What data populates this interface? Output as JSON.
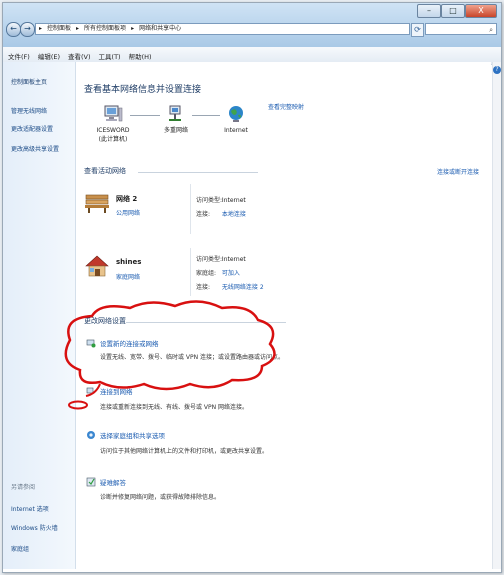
{
  "window": {
    "min_label": "–",
    "max_label": "□",
    "close_label": "X"
  },
  "address_bar": {
    "back_icon": "←",
    "forward_icon": "→",
    "parts": [
      "控制面板",
      "所有控制面板项",
      "网络和共享中心"
    ],
    "separator": "▸",
    "refresh_icon": "⟳",
    "search_icon": "⌕"
  },
  "menu": [
    "文件(F)",
    "编辑(E)",
    "查看(V)",
    "工具(T)",
    "帮助(H)"
  ],
  "sidebar": {
    "items": [
      "控制面板主页",
      "管理无线网络",
      "更改适配器设置",
      "更改高级共享设置"
    ],
    "see_also_title": "另请参阅",
    "see_also": [
      "Internet 选项",
      "Windows 防火墙",
      "家庭组"
    ]
  },
  "main": {
    "heading": "查看基本网络信息并设置连接",
    "full_map_link": "查看完整映射",
    "map_nodes": [
      {
        "label": "ICESWORD",
        "sublabel": "(此计算机)"
      },
      {
        "label": "多重网络",
        "sublabel": ""
      },
      {
        "label": "Internet",
        "sublabel": ""
      }
    ],
    "active_title": "查看活动网络",
    "connect_link": "连接或断开连接",
    "networks": [
      {
        "name": "网络 2",
        "type": "公用网络",
        "rows": [
          {
            "key": "访问类型:",
            "value": "Internet",
            "is_link": false
          },
          {
            "key": "连接:",
            "value": "本地连接",
            "is_link": true
          }
        ]
      },
      {
        "name": "shines",
        "type": "家庭网络",
        "rows": [
          {
            "key": "访问类型:",
            "value": "Internet",
            "is_link": false
          },
          {
            "key": "家庭组:",
            "value": "可加入",
            "is_link": true
          },
          {
            "key": "连接:",
            "value": "无线网络连接 2",
            "is_link": true
          }
        ]
      }
    ],
    "change_title": "更改网络设置",
    "tasks": [
      {
        "title": "设置新的连接或网络",
        "desc": "设置无线、宽带、拨号、临时或 VPN 连接；或设置路由器或访问点。"
      },
      {
        "title": "连接到网络",
        "desc": "连接或重新连接到无线、有线、拨号或 VPN 网络连接。"
      },
      {
        "title": "选择家庭组和共享选项",
        "desc": "访问位于其他网络计算机上的文件和打印机，或更改共享设置。"
      },
      {
        "title": "疑难解答",
        "desc": "诊断并修复网络问题，或获得故障排除信息。"
      }
    ]
  },
  "help_icon": "?",
  "colors": {
    "link": "#1a5bb0",
    "annotation": "#d81010",
    "heading": "#1f3d66"
  }
}
